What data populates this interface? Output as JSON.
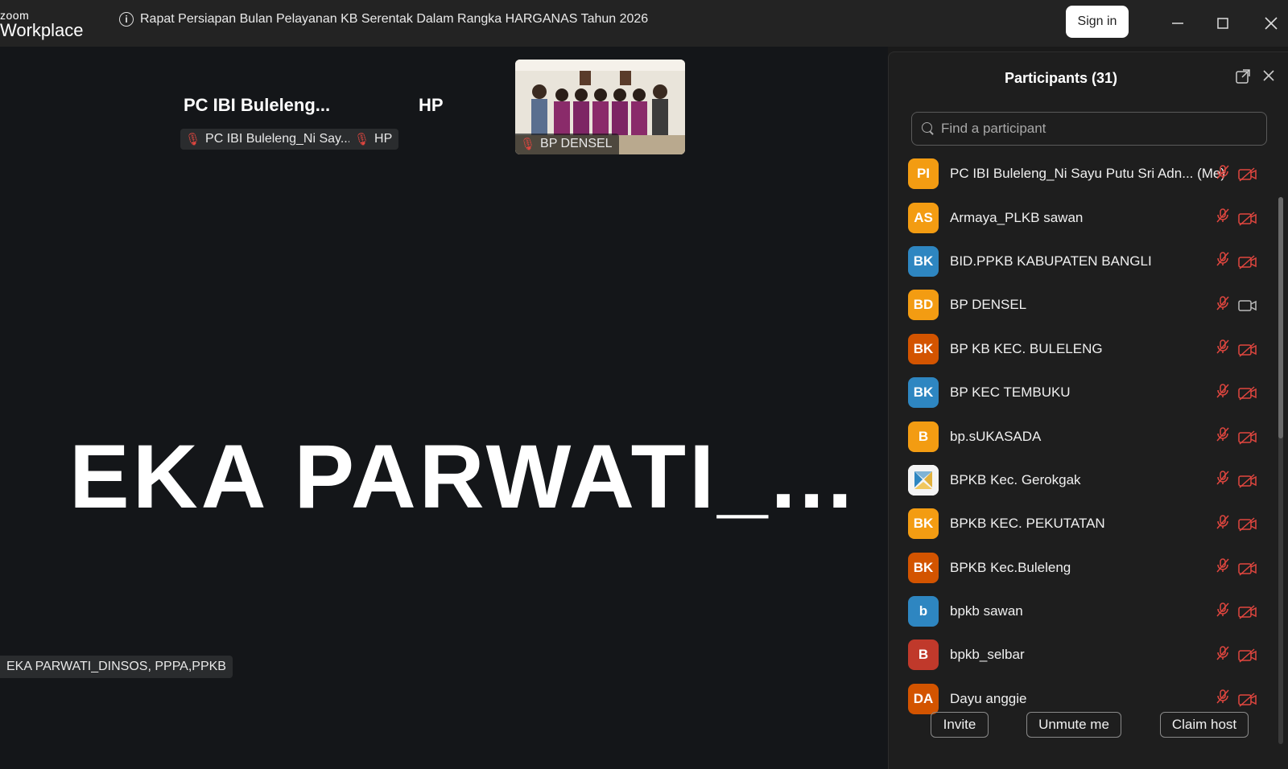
{
  "app": {
    "logo_small": "zoom",
    "logo_big": "Workplace"
  },
  "meeting": {
    "title": "Rapat Persiapan Bulan Pelayanan KB Serentak Dalam Rangka HARGANAS Tahun 2026"
  },
  "titlebar": {
    "signin_label": "Sign in",
    "minimize": "—",
    "maximize": "☐",
    "close": "✕"
  },
  "stage": {
    "thumbs": [
      {
        "name": "PC IBI Buleleng...",
        "tag": "PC IBI Buleleng_Ni Say..."
      },
      {
        "name": "HP",
        "tag": "HP"
      }
    ],
    "video_thumb_tag": "BP DENSEL",
    "active_speaker": "EKA PARWATI_...",
    "active_speaker_tag": "EKA PARWATI_DINSOS, PPPA,PPKB"
  },
  "participants": {
    "title": "Participants (31)",
    "search_placeholder": "Find a participant",
    "list": [
      {
        "initials": "PI",
        "name": "PC IBI Buleleng_Ni Sayu Putu Sri Adn...  (Me)",
        "color": "#f39c12",
        "camera": "off"
      },
      {
        "initials": "AS",
        "name": "Armaya_PLKB sawan",
        "color": "#f39c12",
        "camera": "off"
      },
      {
        "initials": "BK",
        "name": "BID.PPKB KABUPATEN BANGLI",
        "color": "#2e86c1",
        "camera": "off"
      },
      {
        "initials": "BD",
        "name": "BP DENSEL",
        "color": "#f39c12",
        "camera": "on"
      },
      {
        "initials": "BK",
        "name": "BP KB KEC. BULELENG",
        "color": "#d35400",
        "camera": "off"
      },
      {
        "initials": "BK",
        "name": "BP KEC TEMBUKU",
        "color": "#2e86c1",
        "camera": "off"
      },
      {
        "initials": "B",
        "name": "bp.sUKASADA",
        "color": "#f39c12",
        "camera": "off"
      },
      {
        "initials": "",
        "name": "BPKB Kec. Gerokgak",
        "color": "#ffffff",
        "camera": "off",
        "logo": true
      },
      {
        "initials": "BK",
        "name": "BPKB KEC. PEKUTATAN",
        "color": "#f39c12",
        "camera": "off"
      },
      {
        "initials": "BK",
        "name": "BPKB Kec.Buleleng",
        "color": "#d35400",
        "camera": "off"
      },
      {
        "initials": "b",
        "name": "bpkb sawan",
        "color": "#2e86c1",
        "camera": "off"
      },
      {
        "initials": "B",
        "name": "bpkb_selbar",
        "color": "#c0392b",
        "camera": "off"
      },
      {
        "initials": "DA",
        "name": "Dayu anggie",
        "color": "#d35400",
        "camera": "off"
      }
    ],
    "buttons": {
      "invite": "Invite",
      "unmute": "Unmute me",
      "claim_host": "Claim host"
    }
  }
}
